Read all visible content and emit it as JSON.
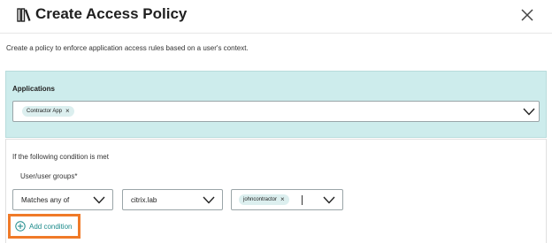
{
  "header": {
    "title": "Create Access Policy",
    "title_icon": "book-shelf-icon",
    "close_icon": "close-icon"
  },
  "description": "Create a policy to enforce application access rules based on a user's context.",
  "applications": {
    "label": "Applications",
    "selected": [
      "Contractor App"
    ],
    "panel_color": "#cdecec"
  },
  "condition": {
    "heading": "If the following condition is met",
    "field_label": "User/user groups*",
    "match_value": "Matches any of",
    "domain_value": "citrix.lab",
    "users_selected": [
      "johncontractor"
    ]
  },
  "add_condition": {
    "label": "Add condition",
    "highlight_color": "#f07a28",
    "text_color": "#1b8a8a"
  }
}
